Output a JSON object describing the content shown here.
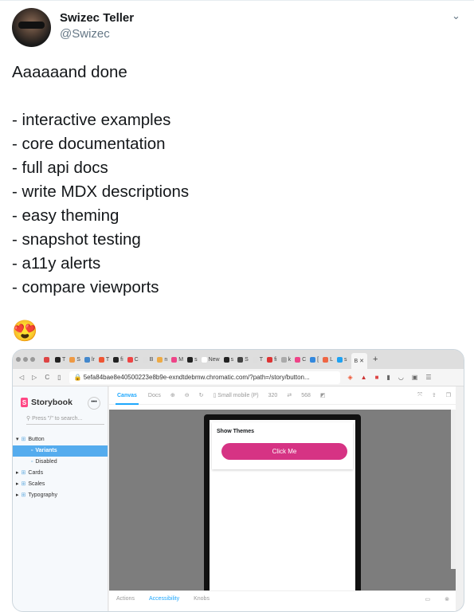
{
  "author": {
    "name": "Swizec Teller",
    "handle": "@Swizec"
  },
  "tweet": {
    "text": "Aaaaaand done\n\n- interactive examples\n- core documentation\n- full api docs\n- write MDX descriptions\n- easy theming\n- snapshot testing\n- a11y alerts\n- compare viewports",
    "emoji": "😍"
  },
  "browser": {
    "tabs": [
      {
        "l": "",
        "c": "#d44"
      },
      {
        "l": "T",
        "c": "#222"
      },
      {
        "l": "S",
        "c": "#e94"
      },
      {
        "l": "lr",
        "c": "#48c"
      },
      {
        "l": "T",
        "c": "#e53"
      },
      {
        "l": "fi",
        "c": "#222"
      },
      {
        "l": "C",
        "c": "#e44"
      },
      {
        "l": "B",
        "c": "#ddd"
      },
      {
        "l": "n",
        "c": "#ea4"
      },
      {
        "l": "M",
        "c": "#e48"
      },
      {
        "l": "s",
        "c": "#222"
      },
      {
        "l": "New",
        "c": "#fff"
      },
      {
        "l": "s",
        "c": "#222"
      },
      {
        "l": "S",
        "c": "#444"
      },
      {
        "l": "T",
        "c": "#ddd"
      },
      {
        "l": "fi",
        "c": "#d33"
      },
      {
        "l": "k",
        "c": "#aaa"
      },
      {
        "l": "C",
        "c": "#e48"
      },
      {
        "l": "[",
        "c": "#38d"
      },
      {
        "l": "L",
        "c": "#e64"
      },
      {
        "l": "s",
        "c": "#1da1f2"
      }
    ],
    "active_tab": "B",
    "new_tab": "+",
    "url": "5efa84bae8e40500223e8b9e-exndtdebmw.chromatic.com/?path=/story/button..."
  },
  "storybook": {
    "brand": "Storybook",
    "more": "•••",
    "search_placeholder": "Press \"/\" to search...",
    "tree": [
      {
        "label": "Button",
        "arrow": "▾",
        "indent": 0
      },
      {
        "label": "Variants",
        "indent": 1,
        "selected": true
      },
      {
        "label": "Disabled",
        "indent": 1
      },
      {
        "label": "Cards",
        "arrow": "▸",
        "indent": 0
      },
      {
        "label": "Scales",
        "arrow": "▸",
        "indent": 0
      },
      {
        "label": "Typography",
        "arrow": "▸",
        "indent": 0
      }
    ],
    "tabs": {
      "canvas": "Canvas",
      "docs": "Docs"
    },
    "viewport": "Small mobile (P)",
    "width": "320",
    "height": "568",
    "swap": "⇄",
    "show_themes": "Show Themes",
    "button_label": "Click Me",
    "addons": {
      "actions": "Actions",
      "accessibility": "Accessibility",
      "knobs": "Knobs"
    },
    "accent": "#1ea7fd",
    "button_color": "#d63384"
  }
}
